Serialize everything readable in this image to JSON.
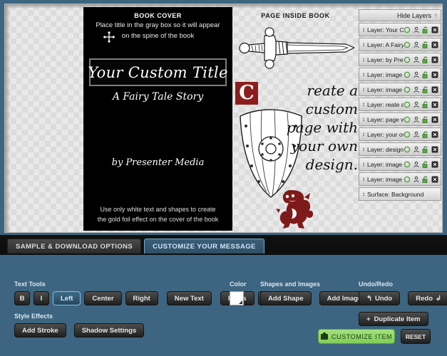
{
  "stage": {
    "book_cover": {
      "header": "BOOK COVER",
      "instruction_line1": "Place title in the gray box so it will appear",
      "instruction_line2": "on the spine of the book",
      "title": "Your Custom Title",
      "subtitle": "A Fairy Tale Story",
      "byline": "by Presenter Media",
      "footer_line1": "Use only white text and shapes to create",
      "footer_line2": "the gold foil effect on the cover of the book",
      "move_cursor_icon": "move-cursor-icon"
    },
    "page_inside": {
      "header": "PAGE INSIDE BOOK",
      "drop_cap": "C",
      "body_line1": "reate a custom",
      "body_line2": "page with",
      "body_line3": "your own",
      "body_line4": "design.",
      "sword_icon": "sword-icon",
      "shield_icon": "shield-icon",
      "lion_icon": "heraldic-lion-icon"
    }
  },
  "layers": {
    "header_label": "Hide Layers",
    "header_caret": "↑",
    "row_icons": {
      "drag": "drag-handle-icon",
      "visibility": "visibility-circle-icon",
      "person": "person-icon",
      "lock": "unlock-icon",
      "delete": "delete-x-icon"
    },
    "items": [
      {
        "label": "Layer: Your Cust..."
      },
      {
        "label": "Layer: A Fairy T..."
      },
      {
        "label": "Layer: by Presen..."
      },
      {
        "label": "Layer: image"
      },
      {
        "label": "Layer: image"
      },
      {
        "label": "Layer: reate a c..."
      },
      {
        "label": "Layer: page with"
      },
      {
        "label": "Layer: your own"
      },
      {
        "label": "Layer: design."
      },
      {
        "label": "Layer: image"
      },
      {
        "label": "Layer: image"
      }
    ],
    "surface": {
      "label": "Surface: Background"
    }
  },
  "tabs": [
    {
      "label": "SAMPLE & DOWNLOAD OPTIONS",
      "active": false
    },
    {
      "label": "CUSTOMIZE YOUR MESSAGE",
      "active": true
    }
  ],
  "toolbar": {
    "text_tools_label": "Text Tools",
    "bold_label": "B",
    "italic_label": "I",
    "align_left_label": "Left",
    "align_center_label": "Center",
    "align_right_label": "Right",
    "new_text_label": "New Text",
    "fonts_label": "Fonts",
    "fonts_caret": "▾",
    "style_effects_label": "Style Effects",
    "add_stroke_label": "Add Stroke",
    "shadow_settings_label": "Shadow Settings",
    "color_label": "Color",
    "color_value": "#ffffff",
    "shapes_images_label": "Shapes and Images",
    "add_shape_label": "Add Shape",
    "add_image_label": "Add Image",
    "undo_redo_label": "Undo/Redo",
    "undo_label": "Undo",
    "undo_icon": "undo-arrow-icon",
    "redo_label": "Redo",
    "redo_icon": "redo-arrow-icon",
    "duplicate_label": "Duplicate Item",
    "duplicate_plus": "+"
  },
  "actions": {
    "customize_label": "CUSTOMIZE ITEM",
    "customize_icon": "camera-icon",
    "reset_label": "RESET"
  },
  "colors": {
    "panel_bg": "#3d6480",
    "accent_blue": "#7cc0e8",
    "green_button": "#7fcf58",
    "drop_cap_red": "#8c1d1d",
    "lion_red": "#7e1a1a"
  }
}
